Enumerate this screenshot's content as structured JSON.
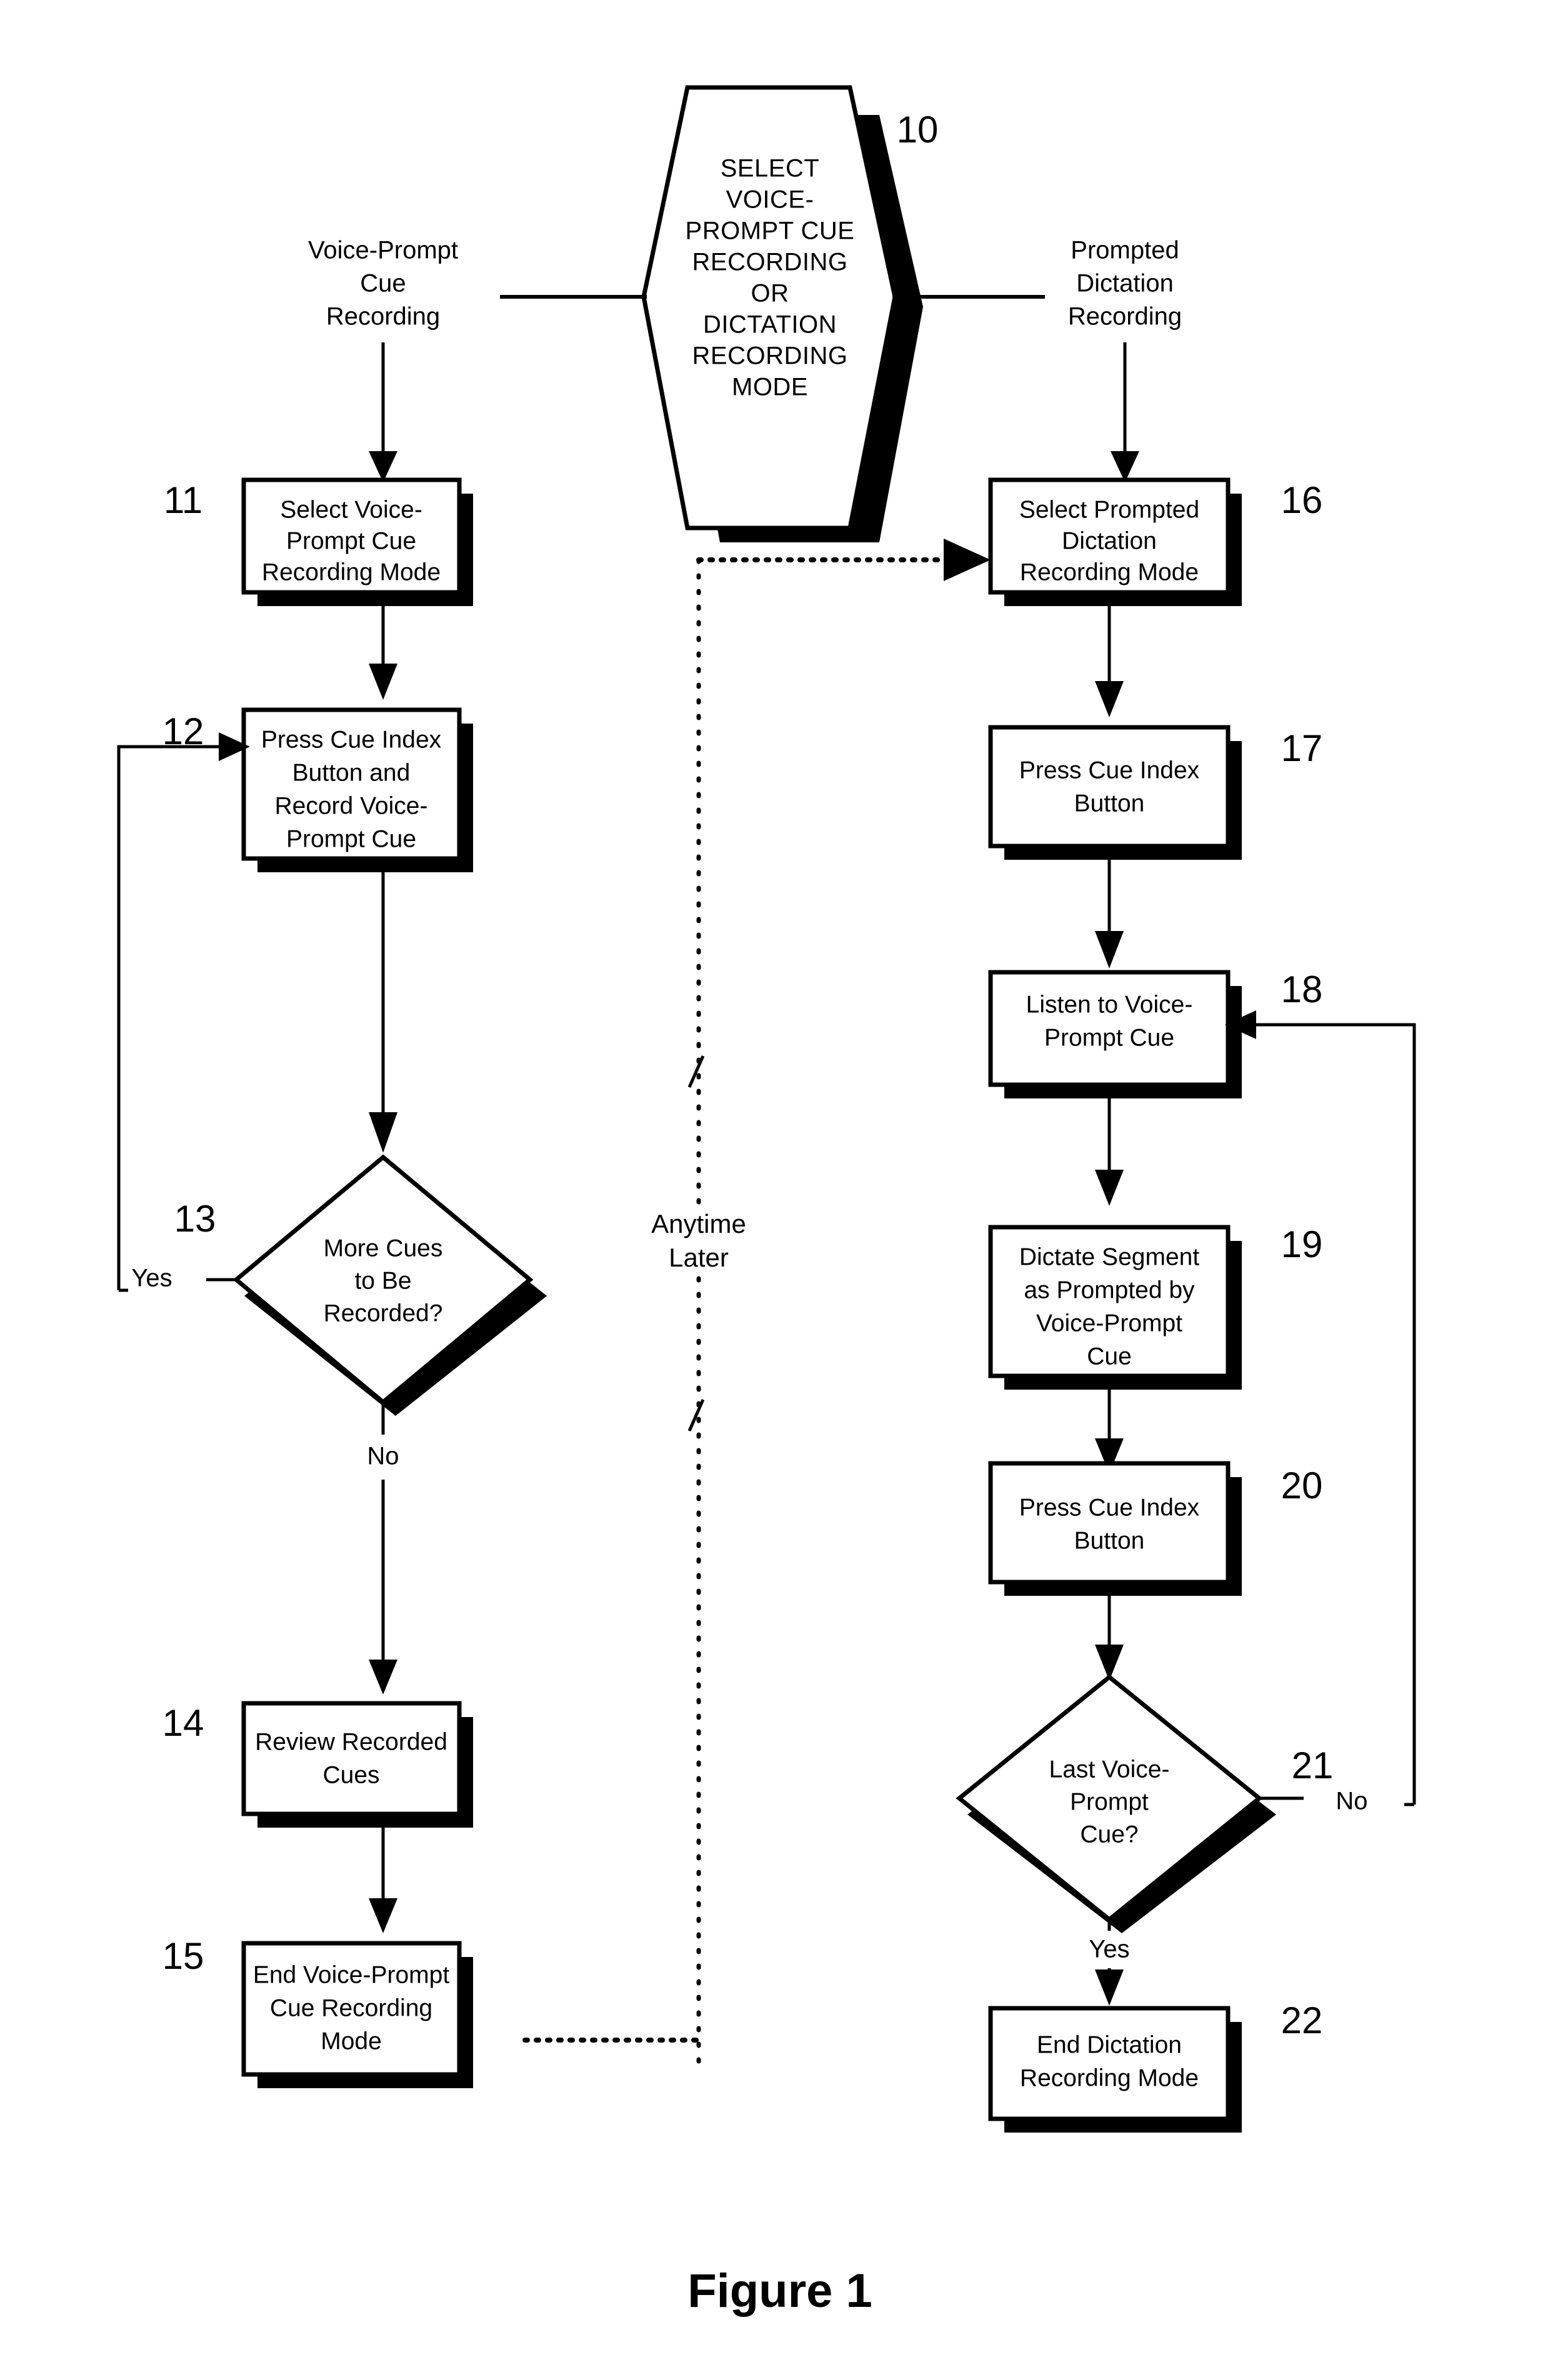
{
  "figure": {
    "caption": "Figure 1"
  },
  "decision_start": {
    "ref": "10",
    "lines": [
      "SELECT",
      "VOICE-",
      "PROMPT CUE",
      "RECORDING",
      "OR",
      "DICTATION",
      "RECORDING",
      "MODE"
    ]
  },
  "branches": {
    "left": {
      "lines": [
        "Voice-Prompt",
        "Cue",
        "Recording"
      ]
    },
    "right": {
      "lines": [
        "Prompted",
        "Dictation",
        "Recording"
      ]
    }
  },
  "anytime_later": {
    "lines": [
      "Anytime",
      "Later"
    ]
  },
  "left_column": [
    {
      "ref": "11",
      "type": "process",
      "lines": [
        "Select Voice-",
        "Prompt Cue",
        "Recording Mode"
      ]
    },
    {
      "ref": "12",
      "type": "process",
      "lines": [
        "Press Cue Index",
        "Button and",
        "Record Voice-",
        "Prompt Cue"
      ]
    },
    {
      "ref": "13",
      "type": "decision",
      "lines": [
        "More Cues",
        "to Be",
        "Recorded?"
      ],
      "yes_label": "Yes",
      "no_label": "No"
    },
    {
      "ref": "14",
      "type": "process",
      "lines": [
        "Review Recorded",
        "Cues"
      ]
    },
    {
      "ref": "15",
      "type": "process",
      "lines": [
        "End Voice-Prompt",
        "Cue Recording",
        "Mode"
      ]
    }
  ],
  "right_column": [
    {
      "ref": "16",
      "type": "process",
      "lines": [
        "Select Prompted",
        "Dictation",
        "Recording Mode"
      ]
    },
    {
      "ref": "17",
      "type": "process",
      "lines": [
        "Press Cue Index",
        "Button"
      ]
    },
    {
      "ref": "18",
      "type": "process",
      "lines": [
        "Listen to Voice-",
        "Prompt Cue"
      ]
    },
    {
      "ref": "19",
      "type": "process",
      "lines": [
        "Dictate Segment",
        "as Prompted by",
        "Voice-Prompt",
        "Cue"
      ]
    },
    {
      "ref": "20",
      "type": "process",
      "lines": [
        "Press Cue Index",
        "Button"
      ]
    },
    {
      "ref": "21",
      "type": "decision",
      "lines": [
        "Last Voice-",
        "Prompt",
        "Cue?"
      ],
      "yes_label": "Yes",
      "no_label": "No"
    },
    {
      "ref": "22",
      "type": "process",
      "lines": [
        "End Dictation",
        "Recording Mode"
      ]
    }
  ],
  "colors": {
    "ink": "#000000",
    "paper": "#ffffff"
  }
}
